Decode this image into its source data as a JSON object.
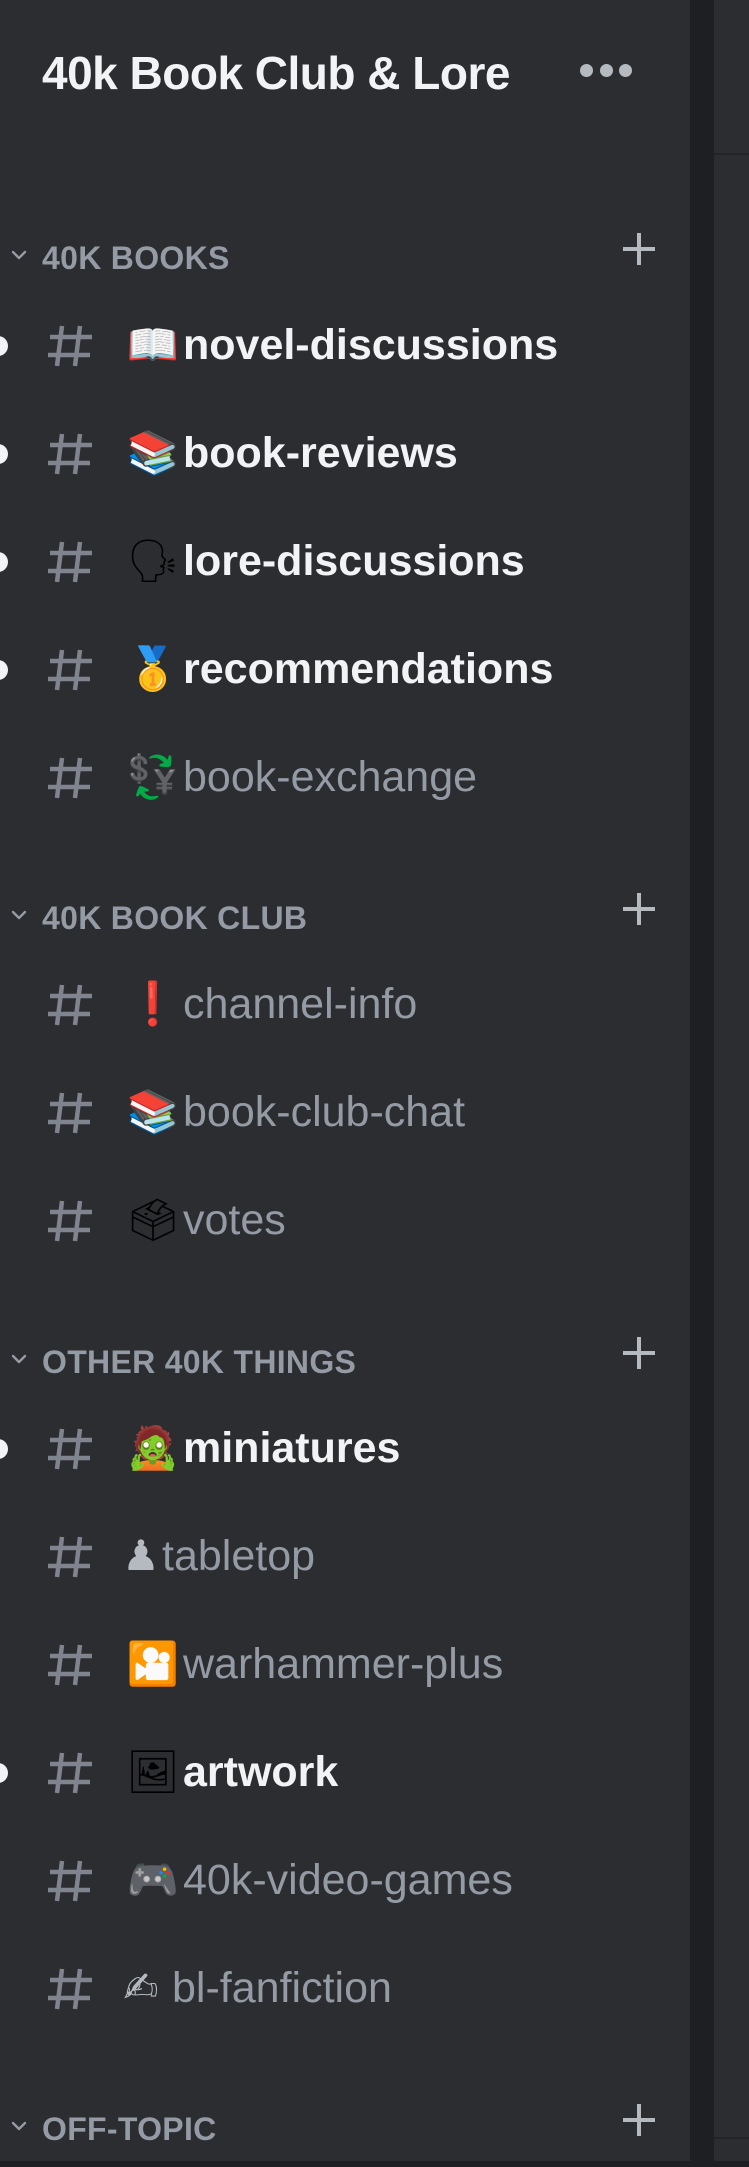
{
  "server": {
    "name": "40k Book Club & Lore",
    "menu_icon": "more-dots-icon"
  },
  "colors": {
    "sidebar_bg": "#2b2d31",
    "gutter_bg": "#1e1f22",
    "title_text": "#f2f3f5",
    "category_text": "#949ba4",
    "channel_text_muted": "#949ba4",
    "channel_text_unread": "#f2f3f5",
    "hash_icon": "#80848e"
  },
  "categories": [
    {
      "label": "40K BOOKS",
      "collapsed": false,
      "channels": [
        {
          "emoji": "📖",
          "name": "novel-discussions",
          "unread": true
        },
        {
          "emoji": "📚",
          "name": "book-reviews",
          "unread": true
        },
        {
          "emoji": "🗣",
          "name": "lore-discussions",
          "unread": true
        },
        {
          "emoji": "🥇",
          "name": "recommendations",
          "unread": true
        },
        {
          "emoji": "💱",
          "name": "book-exchange",
          "unread": false
        }
      ]
    },
    {
      "label": "40K BOOK CLUB",
      "collapsed": false,
      "channels": [
        {
          "emoji": "❗",
          "name": "channel-info",
          "unread": false
        },
        {
          "emoji": "📚",
          "name": "book-club-chat",
          "unread": false
        },
        {
          "emoji": "🗳",
          "name": "votes",
          "unread": false
        }
      ]
    },
    {
      "label": "OTHER 40K THINGS",
      "collapsed": false,
      "channels": [
        {
          "emoji": "🧟",
          "name": "miniatures",
          "unread": true
        },
        {
          "emoji": "♟",
          "name": "tabletop",
          "unread": false
        },
        {
          "emoji": "🎦",
          "name": "warhammer-plus",
          "unread": false
        },
        {
          "emoji": "🖼",
          "name": "artwork",
          "unread": true
        },
        {
          "emoji": "🎮",
          "name": "40k-video-games",
          "unread": false
        },
        {
          "emoji": "✍",
          "name": "bl-fanfiction",
          "unread": false
        }
      ]
    },
    {
      "label": "OFF-TOPIC",
      "collapsed": false,
      "channels": []
    }
  ]
}
